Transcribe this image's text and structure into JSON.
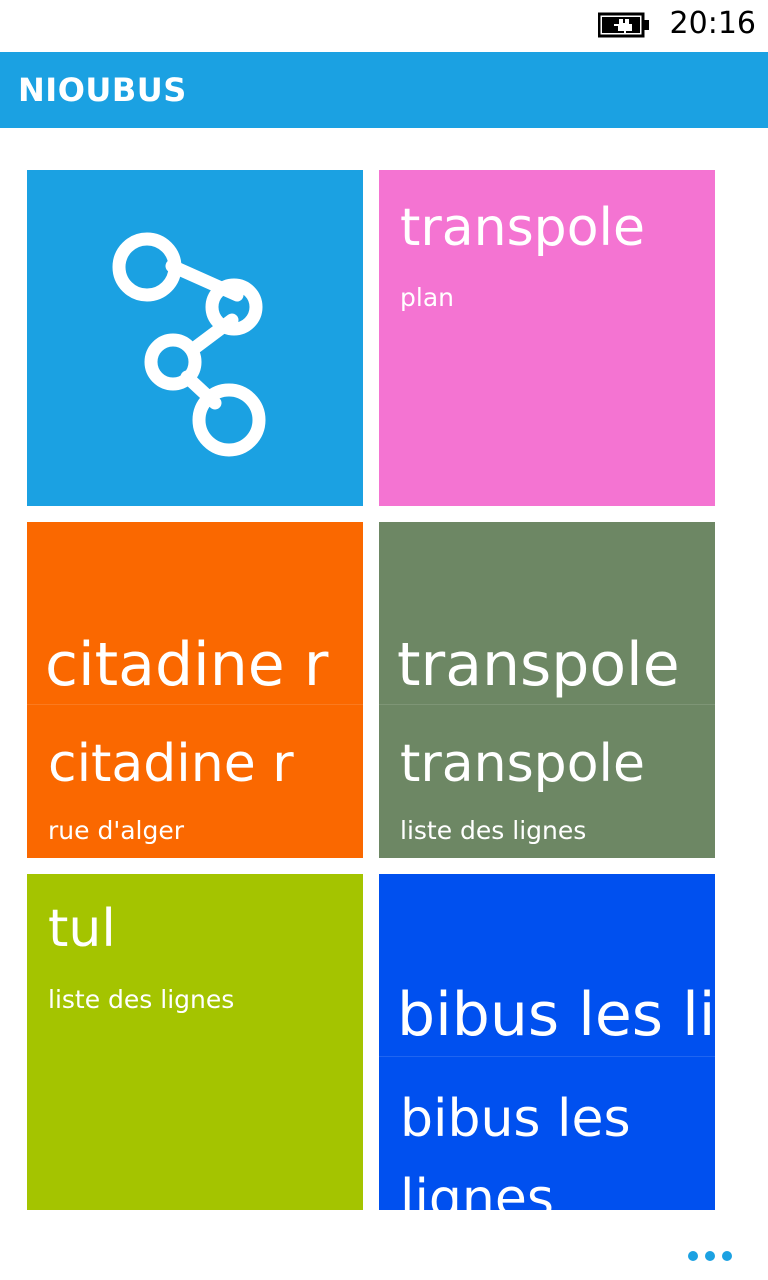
{
  "status": {
    "time": "20:16",
    "battery_icon": "battery-charging-icon"
  },
  "app": {
    "title": "NIOUBUS",
    "accent": "#1ba1e2"
  },
  "tiles": [
    {
      "icon": "route-share-icon",
      "color": "#1ba1e2"
    },
    {
      "title": "transpole",
      "subtitle": "plan",
      "color": "#f474d2"
    },
    {
      "peek_title": "citadine r",
      "title": "citadine r",
      "subtitle": "rue d'alger",
      "color": "#fa6800"
    },
    {
      "peek_title": "transpole",
      "title": "transpole",
      "subtitle": "liste des lignes",
      "color": "#6d8764"
    },
    {
      "title": "tul",
      "subtitle": "liste des lignes",
      "color": "#a4c400"
    },
    {
      "peek_title": "bibus les lig",
      "title": "bibus les lignes",
      "color": "#0050ef"
    }
  ],
  "appbar_more_icon": "more-ellipsis-icon"
}
